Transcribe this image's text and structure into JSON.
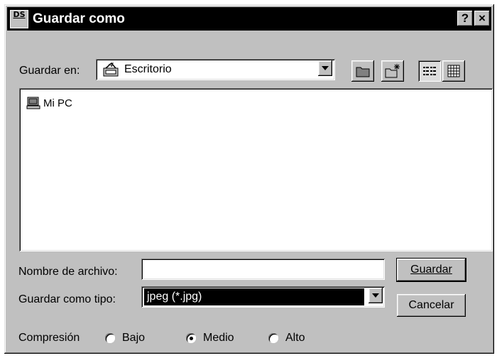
{
  "window": {
    "title": "Guardar como",
    "app_icon_text": "DS",
    "help_button": "?",
    "close_button": "×"
  },
  "location": {
    "label": "Guardar en:",
    "value": "Escritorio"
  },
  "file_list": {
    "items": [
      {
        "label": "Mi PC",
        "icon": "my-computer-icon"
      }
    ]
  },
  "filename": {
    "label": "Nombre de archivo:",
    "value": ""
  },
  "filetype": {
    "label": "Guardar como tipo:",
    "value": "jpeg (*.jpg)"
  },
  "buttons": {
    "save": "Guardar",
    "cancel": "Cancelar"
  },
  "compression": {
    "label": "Compresión",
    "options": [
      "Bajo",
      "Medio",
      "Alto"
    ],
    "selected": "Medio"
  },
  "toolbar": {
    "icons": [
      "up-folder-icon",
      "new-folder-icon",
      "list-view-icon",
      "details-view-icon"
    ]
  },
  "colors": {
    "dialog_bg": "#c0c0c0",
    "titlebar_bg": "#000000",
    "selection_bg": "#000000"
  }
}
